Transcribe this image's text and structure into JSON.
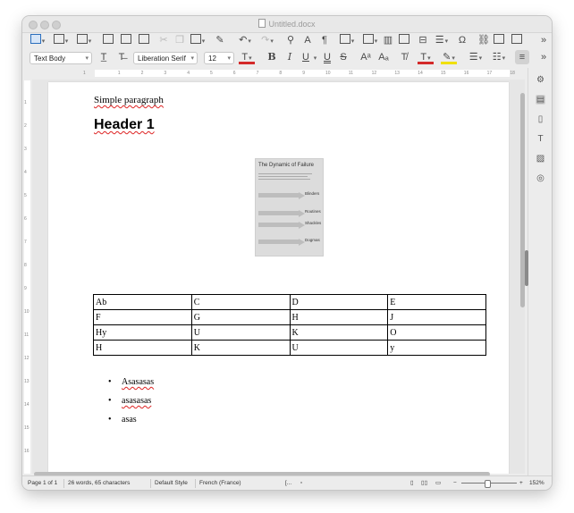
{
  "window": {
    "title": "Untitled.docx"
  },
  "toolbar1": {
    "more": "»"
  },
  "toolbar2": {
    "paragraph_style": "Text Body",
    "font_name": "Liberation Serif",
    "font_size": "12",
    "bold": "B",
    "italic": "I",
    "underline": "U",
    "double_underline": "U",
    "strikethrough": "S",
    "more": "»"
  },
  "ruler": {
    "h_ticks": [
      "1",
      "1",
      "2",
      "3",
      "4",
      "5",
      "6",
      "7",
      "8",
      "9",
      "10",
      "11",
      "12",
      "13",
      "14",
      "15",
      "16",
      "17",
      "18"
    ],
    "v_ticks": [
      "1",
      "2",
      "3",
      "4",
      "5",
      "6",
      "7",
      "8",
      "9",
      "10",
      "11",
      "12",
      "13",
      "14",
      "15",
      "16"
    ]
  },
  "document": {
    "paragraph": "Simple paragraph",
    "heading": "Header 1",
    "figure": {
      "title": "The Dynamic of Failure",
      "labels": [
        "Blinders",
        "Routines",
        "Shackles",
        "Dogmas"
      ]
    },
    "table": [
      [
        "Ab",
        "C",
        "D",
        "E"
      ],
      [
        "F",
        "G",
        "H",
        "J"
      ],
      [
        "Hy",
        "U",
        "K",
        "O"
      ],
      [
        "H",
        "K",
        "U",
        "y"
      ]
    ],
    "bullet_char": "•",
    "bullets": [
      "Asasasas",
      "asasasas",
      "asas"
    ]
  },
  "status": {
    "page": "Page 1 of 1",
    "words": "26 words, 65 characters",
    "style": "Default Style",
    "language": "French (France)",
    "insert_mode": "[...",
    "zoom_minus": "−",
    "zoom_plus": "+",
    "zoom": "152%"
  },
  "colors": {
    "font_color": "#d42a2a",
    "highlight": "#f0e000",
    "spell_error": "#dd2222"
  }
}
